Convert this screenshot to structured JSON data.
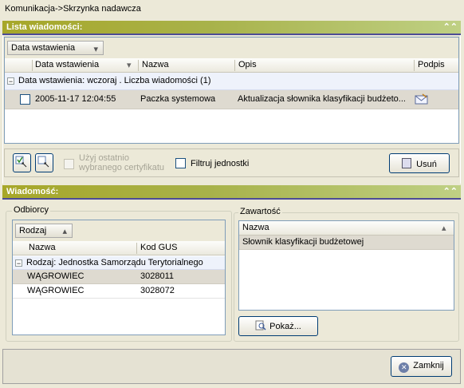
{
  "window": {
    "title": "Komunikacja->Skrzynka nadawcza"
  },
  "list_panel": {
    "header": "Lista wiadomości:",
    "group_by_button": "Data wstawienia",
    "columns": [
      "Data wstawienia",
      "Nazwa",
      "Opis",
      "Podpis"
    ],
    "group_row": "Data wstawienia:  wczoraj . Liczba wiadomości (1)",
    "rows": [
      {
        "date": "2005-11-17 12:04:55",
        "name": "Paczka systemowa",
        "desc": "Aktualizacja  słownika  klasyfikacji  budżeto..."
      }
    ],
    "use_last_cert": "Użyj ostatnio wybranego certyfikatu",
    "filter_units": "Filtruj jednostki",
    "delete_button": "Usuń"
  },
  "message_panel": {
    "header": "Wiadomość:",
    "recipients": {
      "legend": "Odbiorcy",
      "group_by_button": "Rodzaj",
      "columns": [
        "Nazwa",
        "Kod GUS"
      ],
      "group_row": "Rodzaj:  Jednostka Samorządu Terytorialnego",
      "rows": [
        {
          "name": "WĄGROWIEC",
          "code": "3028011"
        },
        {
          "name": "WĄGROWIEC",
          "code": "3028072"
        }
      ]
    },
    "content": {
      "legend": "Zawartość",
      "column": "Nazwa",
      "rows": [
        "Słownik klasyfikacji budżetowej"
      ],
      "show_button": "Pokaż..."
    }
  },
  "footer": {
    "close_button": "Zamknij"
  }
}
